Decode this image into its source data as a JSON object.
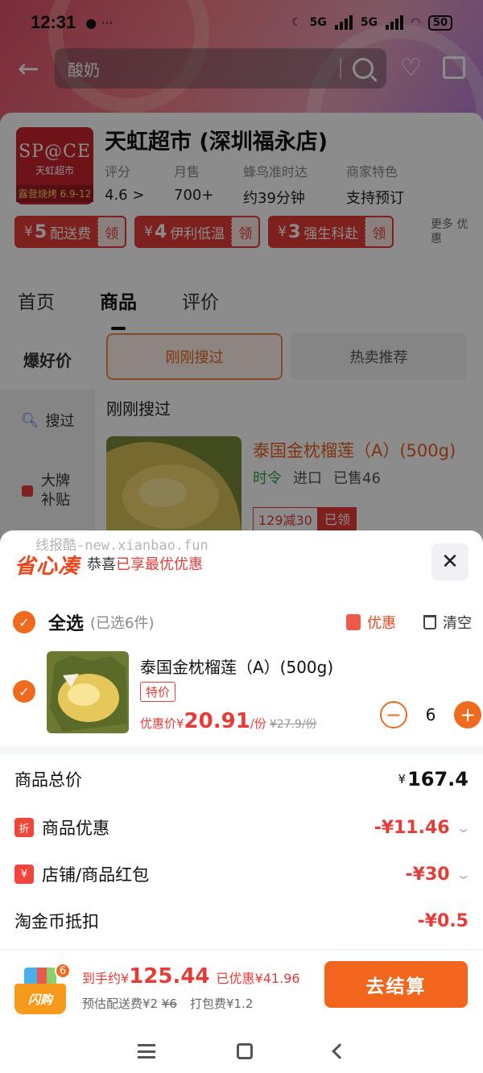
{
  "status_bar": {
    "time": "12:31",
    "network": "5G",
    "battery": "50"
  },
  "search": {
    "query": "酸奶"
  },
  "store": {
    "logo_text": "SP@CE",
    "logo_sub": "天虹超市",
    "logo_banner": "露营烧烤 6.9-12",
    "name": "天虹超市 (深圳福永店)",
    "stats": [
      {
        "label": "评分",
        "value": "4.6 >"
      },
      {
        "label": "月售",
        "value": "700+"
      },
      {
        "label": "蜂鸟准时达",
        "value": "约39分钟"
      },
      {
        "label": "商家特色",
        "value": "支持预订"
      }
    ],
    "coupons": [
      {
        "currency": "¥",
        "amount": "5",
        "desc": "配送费",
        "action": "领"
      },
      {
        "currency": "¥",
        "amount": "4",
        "desc": "伊利低温",
        "action": "领"
      },
      {
        "currency": "¥",
        "amount": "3",
        "desc": "强生科赴",
        "action": "领"
      }
    ],
    "more_coupons": "更多 优惠"
  },
  "tabs": [
    "首页",
    "商品",
    "评价"
  ],
  "sidebar": {
    "hot": "爆好价",
    "searched": "搜过",
    "subsidy": "大牌 补贴"
  },
  "filters": {
    "active": "刚刚搜过",
    "other": "热卖推荐"
  },
  "section_title": "刚刚搜过",
  "bg_product": {
    "name": "泰国金枕榴莲（A）(500g)",
    "tags": [
      "时令",
      "进口",
      "已售46"
    ],
    "promo": "129减30",
    "promo_claimed": "已领"
  },
  "sheet": {
    "watermark": "线报酷-new.xianbao.fun",
    "brand": "省心凑",
    "msg_prefix": "恭喜",
    "msg_highlight": "已享最优优惠",
    "close": "✕",
    "select_all": "全选",
    "selected_count": "(已选6件)",
    "promo_btn": "优惠",
    "clear_btn": "清空",
    "item": {
      "name": "泰国金枕榴莲（A）(500g)",
      "tag": "特价",
      "price_label": "优惠价¥",
      "price": "20.91",
      "price_unit": "/份",
      "old_price": "¥27.9/份",
      "quantity": "6"
    },
    "summary": [
      {
        "label": "商品总价",
        "value": "167.4",
        "currency": "¥",
        "kind": "total"
      },
      {
        "label": "商品优惠",
        "icon": "折",
        "value": "-¥11.46",
        "kind": "neg",
        "chevron": true
      },
      {
        "label": "店铺/商品红包",
        "icon": "¥",
        "value": "-¥30",
        "kind": "neg",
        "chevron": true
      },
      {
        "label": "淘金币抵扣",
        "value": "-¥0.5",
        "kind": "neg"
      }
    ],
    "checkout": {
      "cart_badge": "6",
      "cart_label": "闪购",
      "pay_label": "到手约¥",
      "pay_amount": "125.44",
      "saved": "已优惠¥41.96",
      "delivery_label": "预估配送费¥2",
      "delivery_old": "¥6",
      "packing": "打包费¥1.2",
      "button": "去结算"
    }
  },
  "colors": {
    "accent": "#f2651d",
    "discount_red": "#e63b36"
  }
}
